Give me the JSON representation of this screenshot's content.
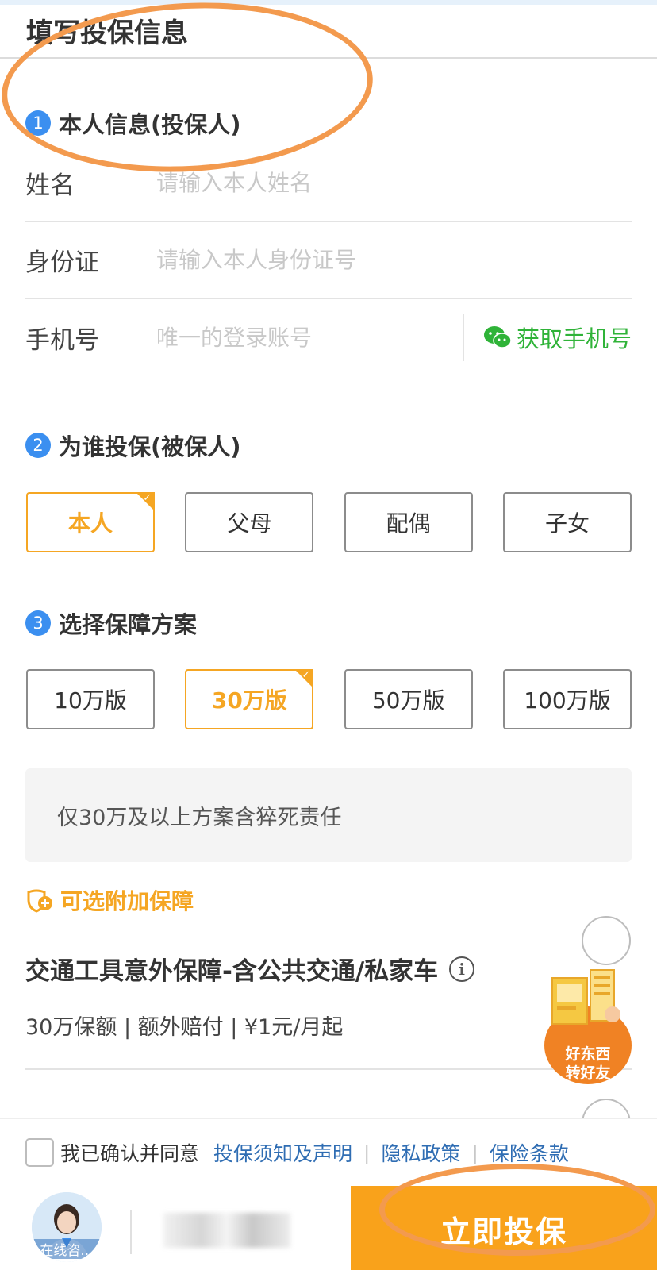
{
  "page_title": "填写投保信息",
  "section1": {
    "num": "1",
    "title": "本人信息(投保人)",
    "fields": [
      {
        "label": "姓名",
        "placeholder": "请输入本人姓名"
      },
      {
        "label": "身份证",
        "placeholder": "请输入本人身份证号"
      },
      {
        "label": "手机号",
        "placeholder": "唯一的登录账号"
      }
    ],
    "get_phone_label": "获取手机号"
  },
  "section2": {
    "num": "2",
    "title": "为谁投保(被保人)",
    "options": [
      "本人",
      "父母",
      "配偶",
      "子女"
    ],
    "selected": "本人"
  },
  "section3": {
    "num": "3",
    "title": "选择保障方案",
    "options": [
      "10万版",
      "30万版",
      "50万版",
      "100万版"
    ],
    "selected": "30万版",
    "note": "仅30万及以上方案含猝死责任"
  },
  "addon": {
    "header": "可选附加保障",
    "title": "交通工具意外保障-含公共交通/私家车",
    "subtitle": "30万保额 | 额外赔付 | ¥1元/月起"
  },
  "share": {
    "line1": "好东西",
    "line2": "转好友"
  },
  "bottom": {
    "agree_text": "我已确认并同意",
    "links": [
      "投保须知及声明",
      "隐私政策",
      "保险条款"
    ],
    "avatar_label": "在线咨...",
    "buy_label": "立即投保"
  },
  "colors": {
    "accent": "#f5a623",
    "step_blue": "#3b8ff0",
    "wechat_green": "#2fb338",
    "link": "#2f6db3",
    "annotation": "#f39a4e"
  }
}
